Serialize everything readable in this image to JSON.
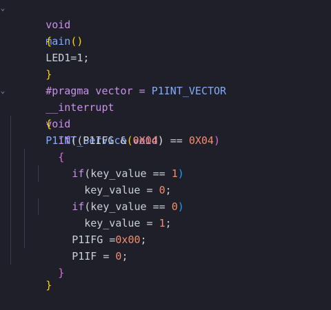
{
  "editor": {
    "lines": [
      {
        "tokens": [
          "void",
          "main",
          "()"
        ]
      },
      {
        "tokens": [
          "{"
        ]
      },
      {
        "tokens": [
          "LED1=1;"
        ]
      },
      {
        "tokens": [
          "}"
        ]
      },
      {
        "tokens": [
          "#pragma vector = ",
          "P1INT_VECTOR"
        ]
      },
      {
        "tokens": [
          "__interrupt",
          "void",
          "P1INT_Service",
          "(",
          "void",
          ")"
        ]
      },
      {
        "tokens": [
          "{"
        ]
      },
      {
        "tokens": [
          "if",
          "((P1IFG & ",
          "0X04",
          ") == ",
          "0X04",
          ")"
        ]
      },
      {
        "tokens": [
          "{"
        ]
      },
      {
        "tokens": [
          "if",
          "(key_value == ",
          "1",
          ")"
        ]
      },
      {
        "tokens": [
          "key_value = ",
          "0",
          ";"
        ]
      },
      {
        "tokens": [
          "if",
          "(key_value == ",
          "0",
          ")"
        ]
      },
      {
        "tokens": [
          "key_value = ",
          "1",
          ";"
        ]
      },
      {
        "tokens": [
          "P1IFG =",
          "0x00",
          ";"
        ]
      },
      {
        "tokens": [
          "P1IF = ",
          "0",
          ";"
        ]
      },
      {
        "tokens": [
          "}"
        ]
      },
      {
        "tokens": [
          "}"
        ]
      }
    ]
  },
  "colors": {
    "background": "#1f1f29",
    "keyword": "#c792ea",
    "function": "#82aaff",
    "number": "#f78c6c",
    "bracket_level1": "#ffd700",
    "bracket_level2": "#da70d6",
    "bracket_level3": "#179fff"
  },
  "icons": {
    "fold_collapse": "chevron-down-icon"
  }
}
